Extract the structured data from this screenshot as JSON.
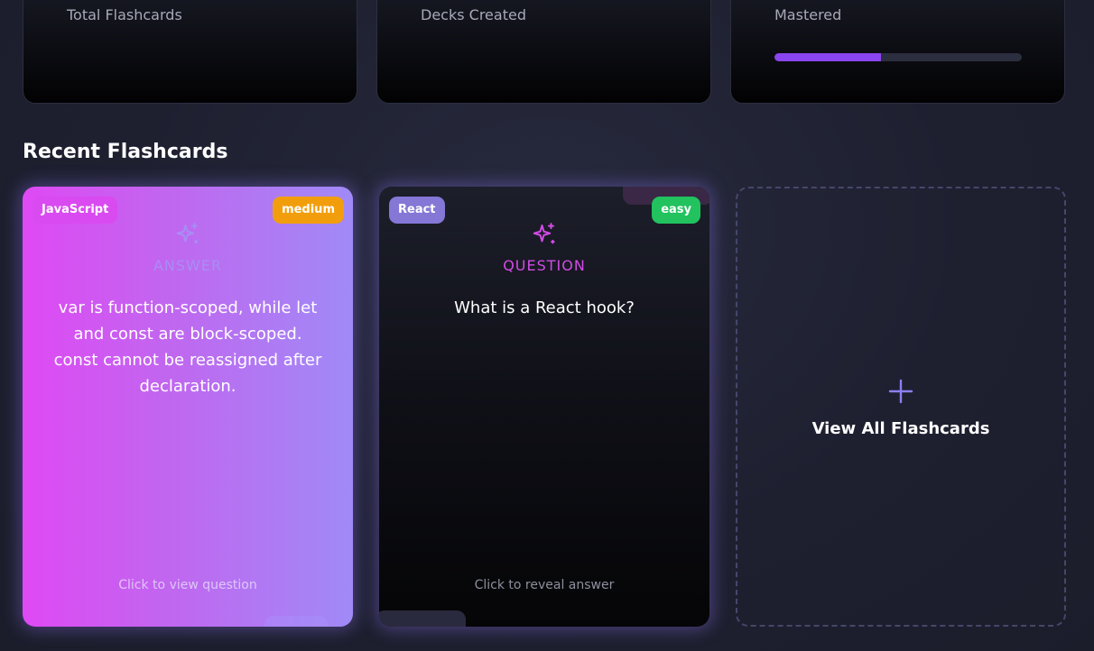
{
  "stats": {
    "total_flashcards_label": "Total Flashcards",
    "decks_created_label": "Decks Created",
    "mastered_label": "Mastered",
    "mastered_progress": 0.43,
    "progress_color": "#8b45ee"
  },
  "recent": {
    "title": "Recent Flashcards",
    "cards": [
      {
        "tag": "JavaScript",
        "difficulty": "medium",
        "side": "ANSWER",
        "text": "var is function-scoped, while let and const are block-scoped. const cannot be reassigned after declaration.",
        "hint": "Click to view question",
        "icon": "sparkle-icon"
      },
      {
        "tag": "React",
        "difficulty": "easy",
        "side": "QUESTION",
        "text": "What is a React hook?",
        "hint": "Click to reveal answer",
        "icon": "sparkle-icon"
      }
    ],
    "view_all_label": "View All Flashcards",
    "view_all_icon": "plus-icon"
  },
  "colors": {
    "accent_purple": "#8b45ee",
    "medium": "#f29e0c",
    "easy": "#22c25f",
    "javascript_tag": "#d94af0",
    "react_tag": "#8477d6"
  }
}
